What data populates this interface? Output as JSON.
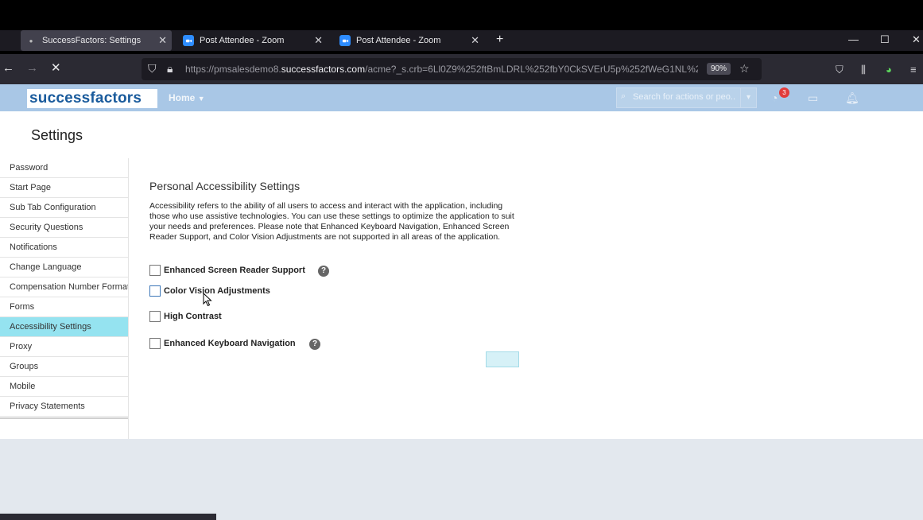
{
  "browser": {
    "tabs": [
      {
        "title": "SuccessFactors: Settings",
        "active": true,
        "icon": "settings-favicon"
      },
      {
        "title": "Post Attendee - Zoom",
        "active": false,
        "icon": "zoom-favicon"
      },
      {
        "title": "Post Attendee - Zoom",
        "active": false,
        "icon": "zoom-favicon"
      }
    ],
    "url_prefix": "https://pmsalesdemo8.",
    "url_host": "successfactors.com",
    "url_path": "/acme?_s.crb=6Ll0Z9%252ftBmLDRL%252fbY0CkSVErU5p%252fWeG1NL%25",
    "zoom": "90%"
  },
  "app": {
    "logo": "successfactors",
    "home_label": "Home",
    "search_placeholder": "Search for actions or peo...",
    "notification_count": "3",
    "colors": {
      "header": "#a9c7e6",
      "active_item": "#95e3f0"
    }
  },
  "page": {
    "title": "Settings",
    "sidebar": [
      "Password",
      "Start Page",
      "Sub Tab Configuration",
      "Security Questions",
      "Notifications",
      "Change Language",
      "Compensation Number Format",
      "Forms",
      "Accessibility Settings",
      "Proxy",
      "Groups",
      "Mobile",
      "Privacy Statements"
    ],
    "active_index": 8,
    "heading": "Personal Accessibility Settings",
    "description": "Accessibility refers to the ability of all users to access and interact with the application, including those who use assistive technologies. You can use these settings to optimize the application to suit your needs and preferences. Please note that Enhanced Keyboard Navigation, Enhanced Screen Reader Support, and Color Vision Adjustments are not supported in all areas of the application.",
    "options": [
      {
        "label": "Enhanced Screen Reader Support",
        "checked": false,
        "help": true
      },
      {
        "label": "Color Vision Adjustments",
        "checked": false,
        "help": false
      },
      {
        "label": "High Contrast",
        "checked": false,
        "help": false
      },
      {
        "label": "Enhanced Keyboard Navigation",
        "checked": false,
        "help": true
      }
    ]
  }
}
